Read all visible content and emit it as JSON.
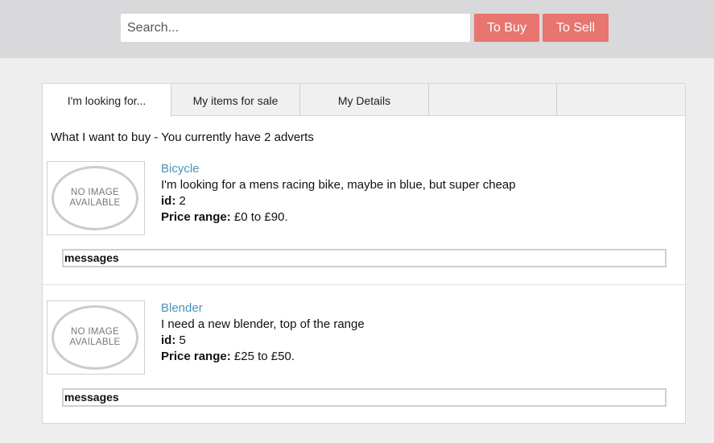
{
  "header": {
    "search_placeholder": "Search...",
    "to_buy_label": "To Buy",
    "to_sell_label": "To Sell"
  },
  "tabs": [
    {
      "label": "I'm looking for...",
      "active": true
    },
    {
      "label": "My items for sale",
      "active": false
    },
    {
      "label": "My Details",
      "active": false
    },
    {
      "label": "",
      "active": false
    },
    {
      "label": "",
      "active": false
    }
  ],
  "main": {
    "heading": "What I want to buy - You currently have 2 adverts",
    "image_placeholder_line1": "NO IMAGE",
    "image_placeholder_line2": "AVAILABLE",
    "adverts": [
      {
        "title": "Bicycle",
        "description": "I'm looking for a mens racing bike, maybe in blue, but super cheap",
        "id_label": "id:",
        "id": "2",
        "price_label": "Price range:",
        "price": "£0 to £90.",
        "messages_label": "messages"
      },
      {
        "title": "Blender",
        "description": "I need a new blender, top of the range",
        "id_label": "id:",
        "id": "5",
        "price_label": "Price range:",
        "price": "£25 to £50.",
        "messages_label": "messages"
      }
    ]
  },
  "colors": {
    "accent_button": "#e8756f",
    "link": "#4a93b8",
    "topbar": "#d9d8da"
  }
}
